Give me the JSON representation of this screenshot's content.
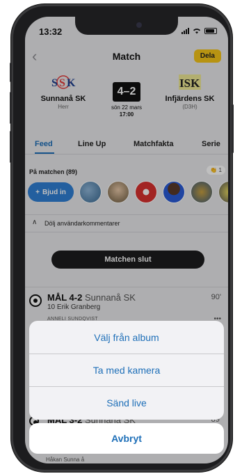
{
  "status": {
    "time": "13:32"
  },
  "header": {
    "title": "Match",
    "share_label": "Dela"
  },
  "match": {
    "home": {
      "name": "Sunnanå SK",
      "sub": "Herr",
      "logo_text": "SSK"
    },
    "away": {
      "name": "Infjärdens SK",
      "sub": "(D3H)",
      "logo_text": "ISK"
    },
    "score": "4–2",
    "date": "sön 22 mars",
    "time": "17:00"
  },
  "tabs": [
    {
      "label": "Feed"
    },
    {
      "label": "Line Up"
    },
    {
      "label": "Matchfakta"
    },
    {
      "label": "Serie"
    }
  ],
  "attendees": {
    "label": "På matchen (89)",
    "clap_count": "1",
    "invite_label": "Bjud in"
  },
  "comments_toggle": "Dölj användarkommentarer",
  "match_ended": "Matchen slut",
  "events": [
    {
      "type": "MÅL 4-2",
      "team": "Sunnanå SK",
      "player": "10 Erik Granberg",
      "minute": "90'",
      "author": "ANNELI SUNDQVIST"
    },
    {
      "type": "MÅL 3-2",
      "team": "Sunnanå SK",
      "minute": "89'"
    }
  ],
  "footer_text": "Håkan Sunna å",
  "action_sheet": {
    "items": [
      "Välj från album",
      "Ta med kamera",
      "Sänd live"
    ],
    "cancel": "Avbryt"
  },
  "colors": {
    "accent": "#1e6fb8",
    "share": "#f5c518",
    "invite": "#2f7fd4"
  }
}
